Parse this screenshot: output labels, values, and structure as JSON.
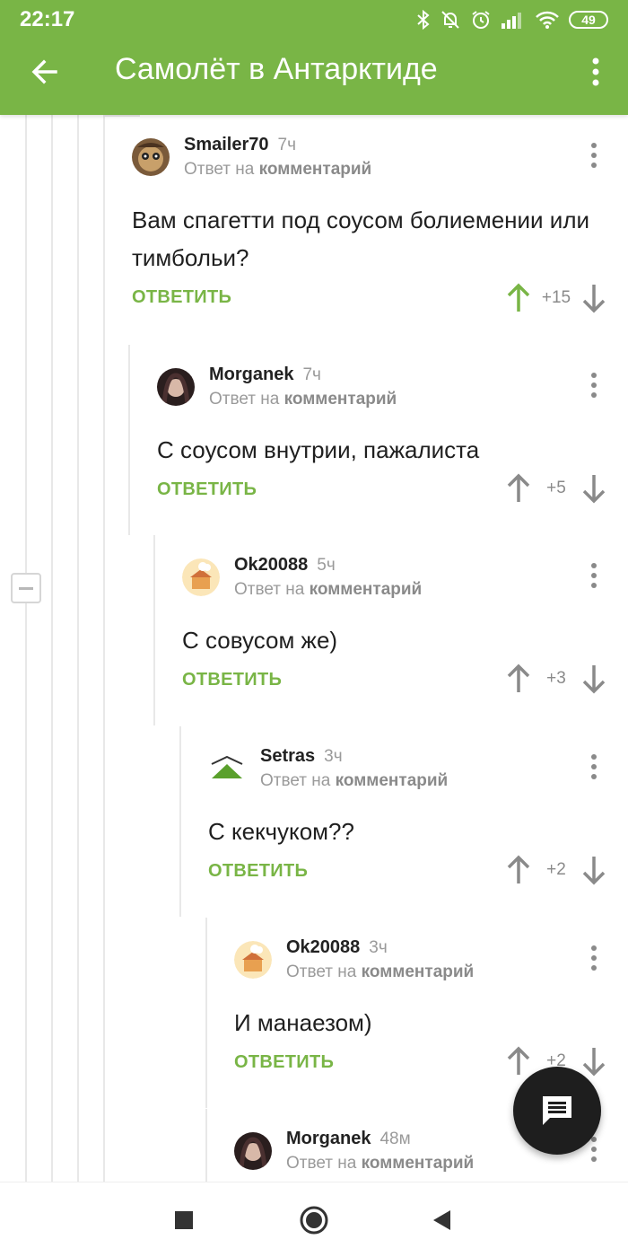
{
  "status_bar": {
    "time": "22:17",
    "battery": "49"
  },
  "app_bar": {
    "title": "Самолёт в Антарктиде"
  },
  "colors": {
    "accent": "#79b546",
    "vote_up_active": "#79b546",
    "muted": "#9a9a9a"
  },
  "labels": {
    "reply": "ОТВЕТИТЬ",
    "reply_to_prefix": "Ответ на",
    "reply_to_link": "комментарий"
  },
  "comments": [
    {
      "author": "Smailer70",
      "age": "7ч",
      "text": "Вам спагетти под соусом болиемении или тимбольи?",
      "score": "+15",
      "upvoted": true
    },
    {
      "author": "Morganek",
      "age": "7ч",
      "text": "С соусом внутрии, пажалиста",
      "score": "+5",
      "upvoted": false
    },
    {
      "author": "Ok20088",
      "age": "5ч",
      "text": "С совусом же)",
      "score": "+3",
      "upvoted": false
    },
    {
      "author": "Setras",
      "age": "3ч",
      "text": "С кекчуком??",
      "score": "+2",
      "upvoted": false
    },
    {
      "author": "Ok20088",
      "age": "3ч",
      "text": "И манаезом)",
      "score": "+2",
      "upvoted": false
    },
    {
      "author": "Morganek",
      "age": "48м",
      "text": "",
      "score": "",
      "upvoted": false
    }
  ]
}
